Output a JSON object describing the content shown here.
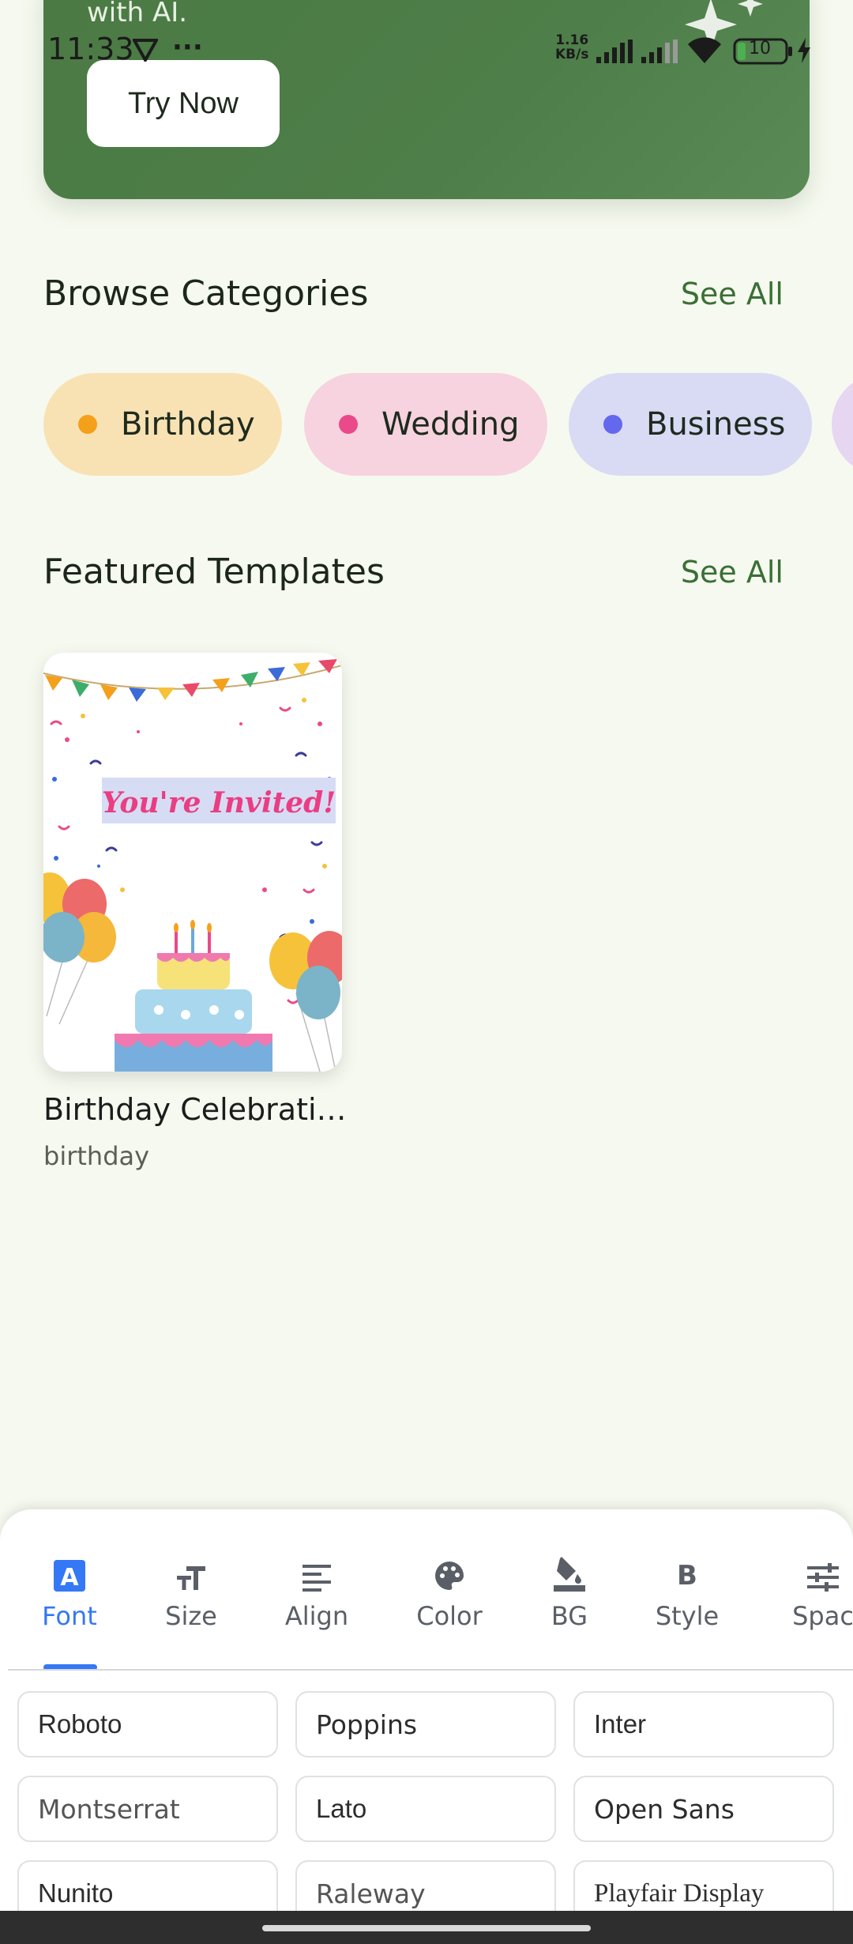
{
  "hero": {
    "subtitle": "with AI.",
    "cta_label": "Try Now"
  },
  "status_bar": {
    "time": "11:33",
    "network_speed_value": "1.16",
    "network_speed_unit": "KB/s",
    "battery_level": "10"
  },
  "categories_section": {
    "title": "Browse Categories",
    "see_all": "See All",
    "chips": [
      {
        "label": "Birthday",
        "bg": "#f8e2b3",
        "dot": "#f5a01a"
      },
      {
        "label": "Wedding",
        "bg": "#f6d3de",
        "dot": "#ea4a8a"
      },
      {
        "label": "Business",
        "bg": "#d9daf3",
        "dot": "#6468ee"
      },
      {
        "label": "",
        "bg": "#e6d6f2",
        "dot": "#a36ad8"
      }
    ]
  },
  "featured_section": {
    "title": "Featured Templates",
    "see_all": "See All",
    "templates": [
      {
        "name": "Birthday Celebrati…",
        "category": "birthday",
        "card_text": "You're Invited!"
      }
    ]
  },
  "editor": {
    "tabs": [
      {
        "label": "Font",
        "icon": "font-icon",
        "active": true
      },
      {
        "label": "Size",
        "icon": "text-size-icon",
        "active": false
      },
      {
        "label": "Align",
        "icon": "align-left-icon",
        "active": false
      },
      {
        "label": "Color",
        "icon": "palette-icon",
        "active": false
      },
      {
        "label": "BG",
        "icon": "fill-bucket-icon",
        "active": false
      },
      {
        "label": "Style",
        "icon": "bold-icon",
        "active": false
      },
      {
        "label": "Spac",
        "icon": "tune-icon",
        "active": false
      }
    ],
    "fonts": [
      "Roboto",
      "Poppins",
      "Inter",
      "Montserrat",
      "Lato",
      "Open Sans",
      "Nunito",
      "Raleway",
      "Playfair Display"
    ]
  },
  "colors": {
    "accent": "#3478f6",
    "brand_green": "#4e7e49",
    "link_green": "#3a6f35"
  }
}
